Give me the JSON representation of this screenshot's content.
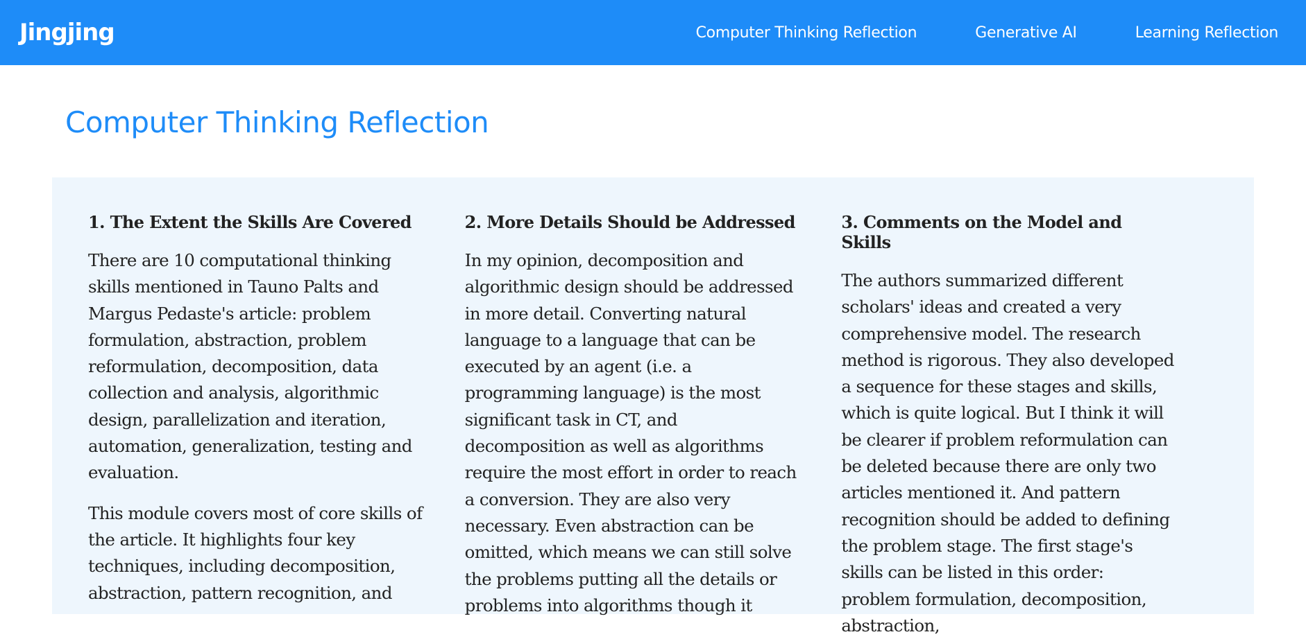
{
  "navbar": {
    "brand": "Jingjing",
    "links": [
      "Computer Thinking Reflection",
      "Generative AI",
      "Learning Reflection"
    ]
  },
  "page": {
    "title": "Computer Thinking Reflection"
  },
  "columns": [
    {
      "heading": "1. The Extent the Skills Are Covered",
      "paragraphs": [
        "There are 10 computational thinking skills mentioned in Tauno Palts and Margus Pedaste's article: problem formulation, abstraction, problem reformulation, decomposition, data collection and analysis, algorithmic design, parallelization and iteration, automation, generalization, testing and evaluation.",
        "This module covers most of core skills of the article. It highlights four key techniques, including decomposition, abstraction, pattern recognition, and"
      ]
    },
    {
      "heading": "2. More Details Should be Addressed",
      "paragraphs": [
        "In my opinion, decomposition and algorithmic design should be addressed in more detail. Converting natural language to a language that can be executed by an agent (i.e. a programming language) is the most significant task in CT, and decomposition as well as algorithms require the most effort in order to reach a conversion. They are also very necessary. Even abstraction can be omitted, which means we can still solve the problems putting all the details or problems into algorithms though it"
      ]
    },
    {
      "heading": "3. Comments on the Model and Skills",
      "paragraphs": [
        "The authors summarized different scholars' ideas and created a very comprehensive model. The research method is rigorous. They also developed a sequence for these stages and skills, which is quite logical. But I think it will be clearer if problem reformulation can be deleted because there are only two articles mentioned it. And pattern recognition should be added to defining the problem stage. The first stage's skills can be listed in this order: problem formulation, decomposition, abstraction,"
      ]
    }
  ]
}
